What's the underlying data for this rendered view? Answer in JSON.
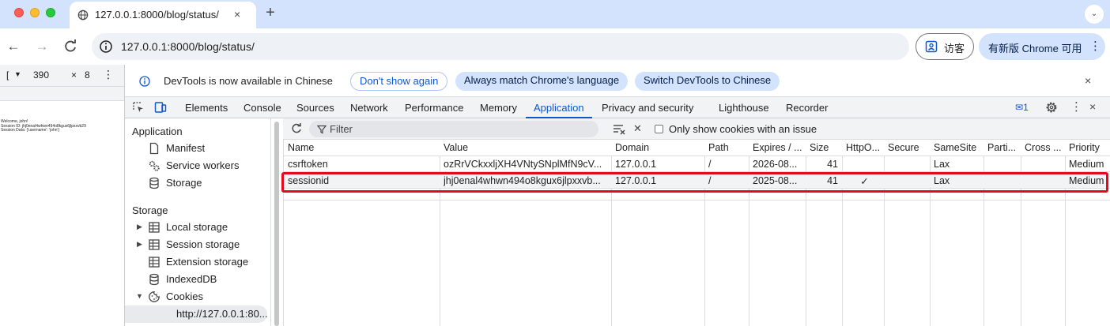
{
  "browser": {
    "tab_title": "127.0.0.1:8000/blog/status/",
    "tab_close": "×",
    "new_tab": "+",
    "tab_menu": "⌄",
    "url": "127.0.0.1:8000/blog/status/",
    "guest_label": "访客",
    "update_label": "有新版 Chrome 可用",
    "update_more": "⋮"
  },
  "device": {
    "bracket": "[",
    "caret": "▼",
    "width": "390",
    "times": "×",
    "height": "8",
    "more": "⋮"
  },
  "page_preview": {
    "line1": "Welcome, john!",
    "line2": "Session ID: jhj0enal4whwn494o8kgux6jlpxxvb29",
    "line3": "Session Data: {'username': 'john'}"
  },
  "infobar": {
    "message": "DevTools is now available in Chinese",
    "dont_show": "Don't show again",
    "match_language": "Always match Chrome's language",
    "switch_chinese": "Switch DevTools to Chinese",
    "close": "×"
  },
  "devtools_tabs": [
    "Elements",
    "Console",
    "Sources",
    "Network",
    "Performance",
    "Memory",
    "Application",
    "Privacy and security",
    "Lighthouse",
    "Recorder"
  ],
  "devtools_active_tab": "Application",
  "devtools_issues": "1",
  "devtools_more": "⋮",
  "devtools_close": "×",
  "sidebar": {
    "app_heading": "Application",
    "app_items": [
      "Manifest",
      "Service workers",
      "Storage"
    ],
    "storage_heading": "Storage",
    "storage_items": [
      "Local storage",
      "Session storage",
      "Extension storage",
      "IndexedDB",
      "Cookies"
    ],
    "cookie_origin": "http://127.0.0.1:80..."
  },
  "cookies": {
    "filter_placeholder": "Filter",
    "delete_glyph": "✕",
    "only_issue_label": "Only show cookies with an issue",
    "columns": [
      "Name",
      "Value",
      "Domain",
      "Path",
      "Expires / ...",
      "Size",
      "HttpO...",
      "Secure",
      "SameSite",
      "Parti...",
      "Cross ...",
      "Priority"
    ],
    "rows": [
      [
        "csrftoken",
        "ozRrVCkxxljXH4VNtySNplMfN9cV...",
        "127.0.0.1",
        "/",
        "2026-08...",
        "41",
        "",
        "",
        "Lax",
        "",
        "",
        "Medium"
      ],
      [
        "sessionid",
        "jhj0enal4whwn494o8kgux6jlpxxvb...",
        "127.0.0.1",
        "/",
        "2025-08...",
        "41",
        "✓",
        "",
        "Lax",
        "",
        "",
        "Medium"
      ]
    ]
  },
  "colors": {
    "accent": "#0b57d0",
    "highlight": "#e5091f",
    "tabstrip": "#d3e3fd"
  }
}
